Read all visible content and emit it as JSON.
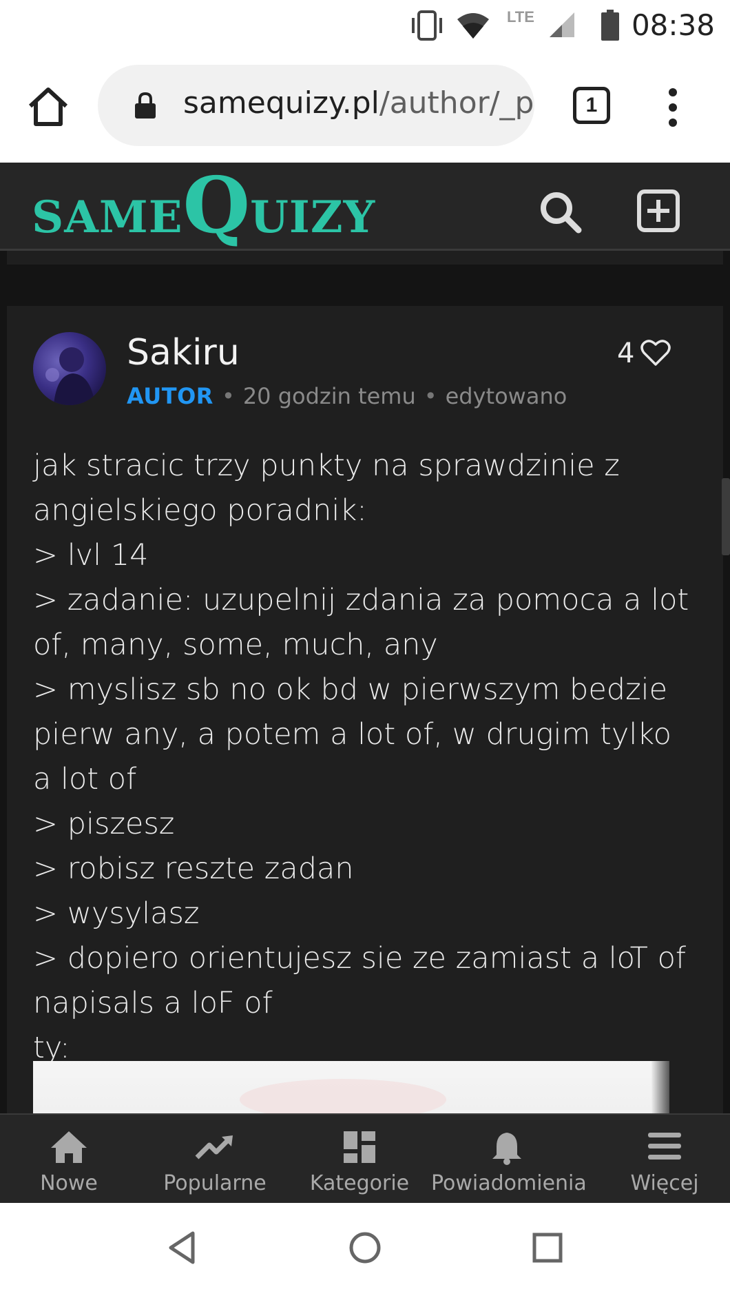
{
  "status_bar": {
    "network": "LTE",
    "time": "08:38"
  },
  "browser": {
    "url_domain": "samequizy.pl",
    "url_path": "/author/_p",
    "tab_count": "1"
  },
  "site": {
    "logo_small1": "SAME",
    "logo_big": "Q",
    "logo_small2": "UIZY",
    "brand_color": "#2cc4a6"
  },
  "comment": {
    "author": "Sakiru",
    "badge": "AUTOR",
    "time_ago": "20 godzin temu",
    "edited": "edytowano",
    "likes": "4",
    "lines": [
      "jak stracic trzy punkty na sprawdzinie z",
      "angielskiego poradnik:",
      "> lvl 14",
      "> zadanie: uzupelnij zdania za pomoca a lot",
      "of, many, some, much, any",
      "> myslisz sb no ok bd w pierwszym bedzie",
      "pierw any, a potem a lot of, w drugim tylko",
      "a lot of",
      "> piszesz",
      "> robisz reszte zadan",
      "> wysylasz",
      "> dopiero orientujesz sie ze zamiast a loT of",
      "napisals a loF of",
      "ty:"
    ]
  },
  "bottom_nav": {
    "items": [
      {
        "label": "Nowe",
        "icon": "home-icon"
      },
      {
        "label": "Popularne",
        "icon": "trending-icon"
      },
      {
        "label": "Kategorie",
        "icon": "grid-icon"
      },
      {
        "label": "Powiadomienia",
        "icon": "bell-icon"
      },
      {
        "label": "Więcej",
        "icon": "menu-icon"
      }
    ]
  }
}
